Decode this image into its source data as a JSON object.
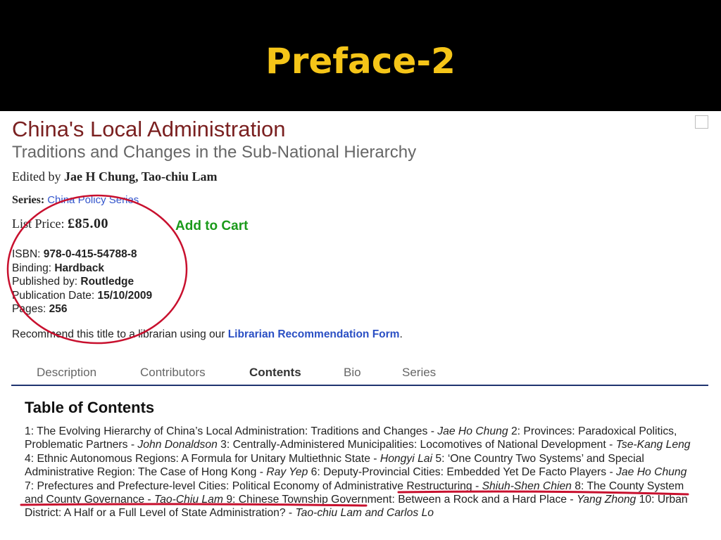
{
  "slide": {
    "title": "Preface-2"
  },
  "book": {
    "title": "China's Local Administration",
    "subtitle": "Traditions and Changes in the Sub-National Hierarchy",
    "edited_by_label": "Edited by",
    "editors": "Jae H Chung, Tao-chiu Lam",
    "series_label": "Series:",
    "series_name": "China Policy Series",
    "list_price_label": "List Price:",
    "list_price": "£85.00",
    "add_to_cart": "Add to Cart",
    "isbn_label": "ISBN:",
    "isbn": "978-0-415-54788-8",
    "binding_label": "Binding:",
    "binding": "Hardback",
    "publisher_label": "Published by:",
    "publisher": "Routledge",
    "pub_date_label": "Publication Date:",
    "pub_date": "15/10/2009",
    "pages_label": "Pages:",
    "pages": "256",
    "recommend_prefix": "Recommend this title to a librarian using our",
    "recommend_link": "Librarian Recommendation Form",
    "recommend_suffix": "."
  },
  "tabs": [
    {
      "label": "Description",
      "active": false
    },
    {
      "label": "Contributors",
      "active": false
    },
    {
      "label": "Contents",
      "active": true
    },
    {
      "label": "Bio",
      "active": false
    },
    {
      "label": "Series",
      "active": false
    }
  ],
  "toc": {
    "heading": "Table of Contents",
    "chapters": [
      {
        "num": "1:",
        "title": "The Evolving Hierarchy of China’s Local Administration: Traditions and Changes -",
        "author": "Jae Ho Chung"
      },
      {
        "num": "2:",
        "title": "Provinces: Paradoxical Politics, Problematic Partners -",
        "author": "John Donaldson"
      },
      {
        "num": "3:",
        "title": "Centrally-Administered Municipalities: Locomotives of National Development -",
        "author": "Tse-Kang Leng"
      },
      {
        "num": "4:",
        "title": "Ethnic Autonomous Regions: A Formula for Unitary Multiethnic State -",
        "author": "Hongyi Lai"
      },
      {
        "num": "5:",
        "title": "‘One Country Two Systems’ and Special Administrative Region: The Case of Hong Kong -",
        "author": "Ray Yep"
      },
      {
        "num": "6:",
        "title": "Deputy-Provincial Cities: Embedded Yet De Facto Players -",
        "author": "Jae Ho Chung"
      },
      {
        "num": "7:",
        "title": "Prefectures and Prefecture-level Cities: Political Economy of Administrative Restructuring -",
        "author": "Shiuh-Shen Chien"
      },
      {
        "num": "8:",
        "title": "The County System and County Governance -",
        "author": "Tao-Chiu Lam"
      },
      {
        "num": "9:",
        "title": "Chinese Township Government: Between a Rock and a Hard Place -",
        "author": "Yang Zhong"
      },
      {
        "num": "10:",
        "title": "Urban District: A Half or a Full Level of State Administration? -",
        "author": "Tao-chiu Lam and Carlos Lo"
      }
    ]
  },
  "annotation": {
    "color": "#c8102e"
  }
}
